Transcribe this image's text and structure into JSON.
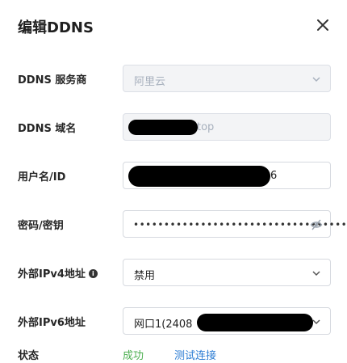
{
  "dialog": {
    "title": "编辑DDNS",
    "close_icon": "close-icon"
  },
  "provider": {
    "label": "DDNS 服务商",
    "value": "阿里云"
  },
  "domain": {
    "label": "DDNS 域名",
    "value_suffix": "top"
  },
  "username": {
    "label": "用户名/ID",
    "value_suffix": "6"
  },
  "password": {
    "label": "密码/密钥",
    "masked": "••••••••••••••••••••••••••••••••••••",
    "eye_icon": "eye-off-icon"
  },
  "ipv4": {
    "label": "外部IPv4地址",
    "info_icon": "info-icon",
    "value": "禁用"
  },
  "ipv6": {
    "label": "外部IPv6地址",
    "value_prefix": "网口1(2408"
  },
  "status": {
    "label": "状态",
    "value": "成功",
    "test_link": "测试连接"
  },
  "colors": {
    "success": "#4caf50",
    "link": "#2b7cd3",
    "disabled_bg": "#f3f4f6"
  }
}
